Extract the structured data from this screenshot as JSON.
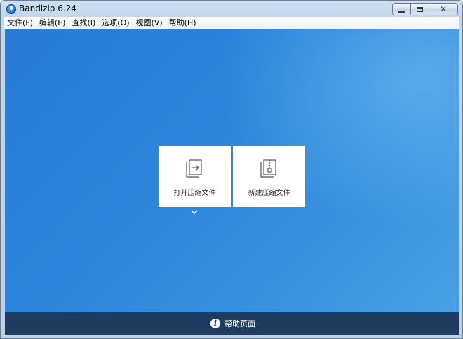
{
  "window": {
    "title": "Bandizip 6.24",
    "controls": {
      "minimize_icon": "minimize-icon",
      "maximize_icon": "maximize-icon",
      "close_icon": "close-icon",
      "close_glyph": "✕"
    }
  },
  "menu": {
    "items": [
      {
        "label": "文件(F)"
      },
      {
        "label": "编辑(E)"
      },
      {
        "label": "查找(I)"
      },
      {
        "label": "选项(O)"
      },
      {
        "label": "视图(V)"
      },
      {
        "label": "帮助(H)"
      }
    ]
  },
  "main": {
    "background_color": "#2c85dc",
    "actions": [
      {
        "label": "打开压缩文件",
        "icon": "open-archive-icon"
      },
      {
        "label": "新建压缩文件",
        "icon": "new-archive-icon"
      }
    ],
    "expand_icon": "chevron-down-icon"
  },
  "footer": {
    "background_color": "#1e3c5f",
    "help_label": "帮助页面",
    "help_icon": "info-icon",
    "help_icon_glyph": "i"
  }
}
